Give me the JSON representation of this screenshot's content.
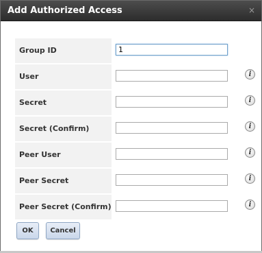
{
  "dialog": {
    "title": "Add Authorized Access",
    "close_glyph": "×"
  },
  "fields": [
    {
      "label": "Group ID",
      "value": "1",
      "has_info": false
    },
    {
      "label": "User",
      "value": "",
      "has_info": true
    },
    {
      "label": "Secret",
      "value": "",
      "has_info": true
    },
    {
      "label": "Secret (Confirm)",
      "value": "",
      "has_info": true
    },
    {
      "label": "Peer User",
      "value": "",
      "has_info": true
    },
    {
      "label": "Peer Secret",
      "value": "",
      "has_info": true
    },
    {
      "label": "Peer Secret (Confirm)",
      "value": "",
      "has_info": true
    }
  ],
  "info_icon_glyph": "i",
  "buttons": {
    "ok": "OK",
    "cancel": "Cancel"
  }
}
